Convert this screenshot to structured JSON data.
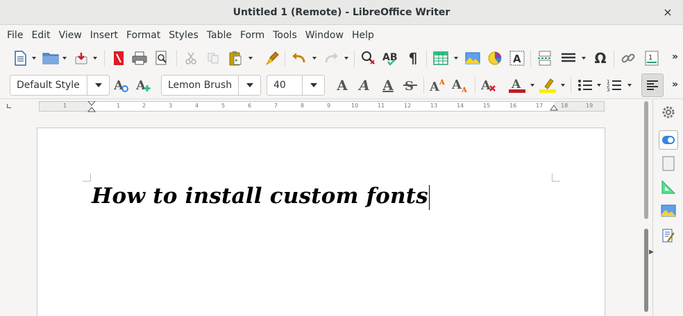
{
  "window": {
    "title": "Untitled 1 (Remote) - LibreOffice Writer",
    "close_glyph": "×"
  },
  "menu": [
    "File",
    "Edit",
    "View",
    "Insert",
    "Format",
    "Styles",
    "Table",
    "Form",
    "Tools",
    "Window",
    "Help"
  ],
  "formatting": {
    "paragraph_style": "Default Style",
    "font_name": "Lemon Brush",
    "font_size": "40"
  },
  "ruler": {
    "numbers": [
      "1",
      "1",
      "2",
      "3",
      "4",
      "5",
      "6",
      "7",
      "8",
      "9",
      "10",
      "11",
      "12",
      "13",
      "14",
      "15",
      "16",
      "17",
      "18",
      "19"
    ]
  },
  "document": {
    "text": "How to install custom fonts"
  },
  "toolbar": {
    "more_glyph": "»"
  },
  "colors": {
    "font_color": "#c01c28",
    "highlight_color": "#f6f000",
    "accent_blue": "#3584e4"
  }
}
